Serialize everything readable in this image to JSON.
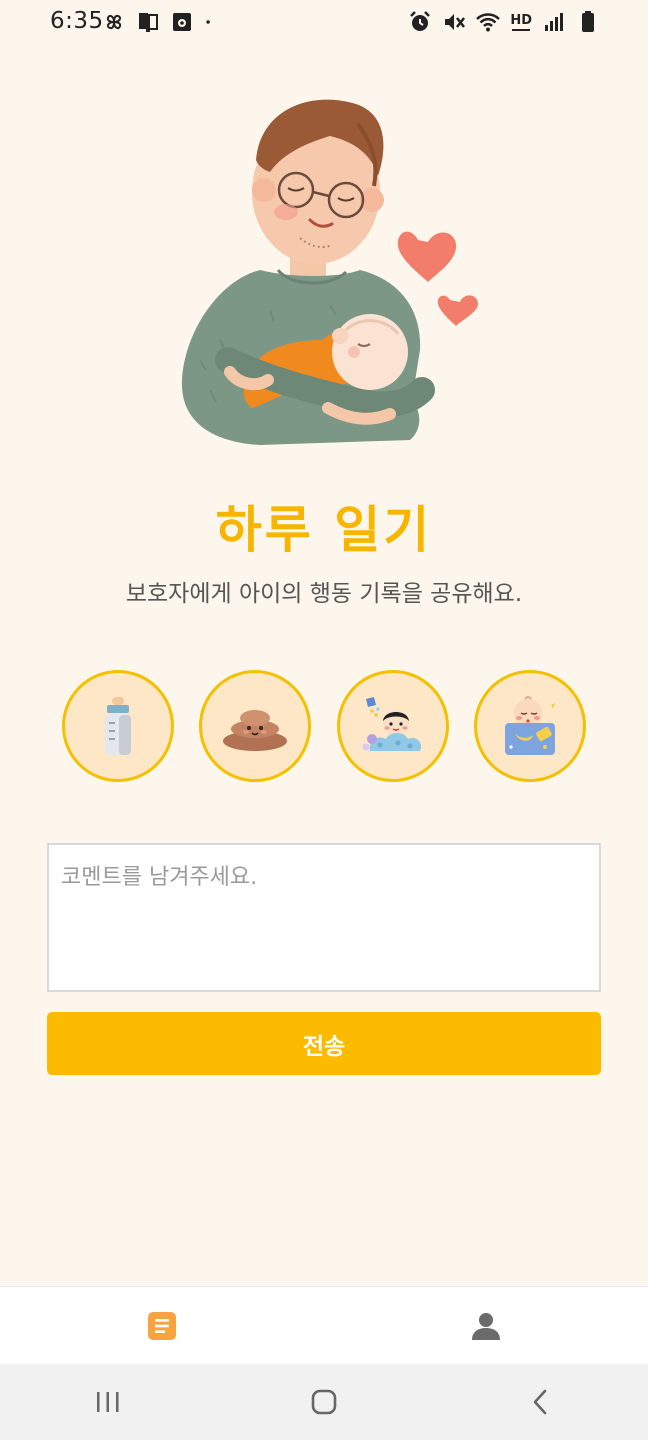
{
  "status_bar": {
    "time": "6:35",
    "left_icons": [
      "pinwheel-icon",
      "sim-icon",
      "media-icon",
      "dot-icon"
    ],
    "right_icons": [
      "alarm-icon",
      "mute-icon",
      "wifi-icon",
      "hd-voice-icon",
      "signal-icon",
      "battery-icon"
    ],
    "hd_label": "HD"
  },
  "hero": {
    "icon": "parent-holding-baby-illustration"
  },
  "header": {
    "title": "하루 일기",
    "subtitle": "보호자에게 아이의 행동 기록을 공유해요."
  },
  "activities": [
    {
      "icon": "milk-bottle-icon"
    },
    {
      "icon": "poop-icon"
    },
    {
      "icon": "bath-icon"
    },
    {
      "icon": "sleep-icon"
    }
  ],
  "comment": {
    "placeholder": "코멘트를 남겨주세요.",
    "value": ""
  },
  "actions": {
    "send_label": "전송"
  },
  "bottom_nav": {
    "tabs": [
      {
        "icon": "diary-icon",
        "active": true
      },
      {
        "icon": "profile-icon",
        "active": false
      }
    ]
  },
  "system_nav": {
    "buttons": [
      "recent-apps-icon",
      "home-icon",
      "back-icon"
    ]
  },
  "colors": {
    "background": "#fdf6ec",
    "accent": "#fdbb00",
    "title": "#f7b500",
    "circle_fill": "#fde7c6",
    "circle_border": "#f5c000",
    "nav_active": "#f7a440",
    "nav_inactive": "#6b6b6b"
  }
}
